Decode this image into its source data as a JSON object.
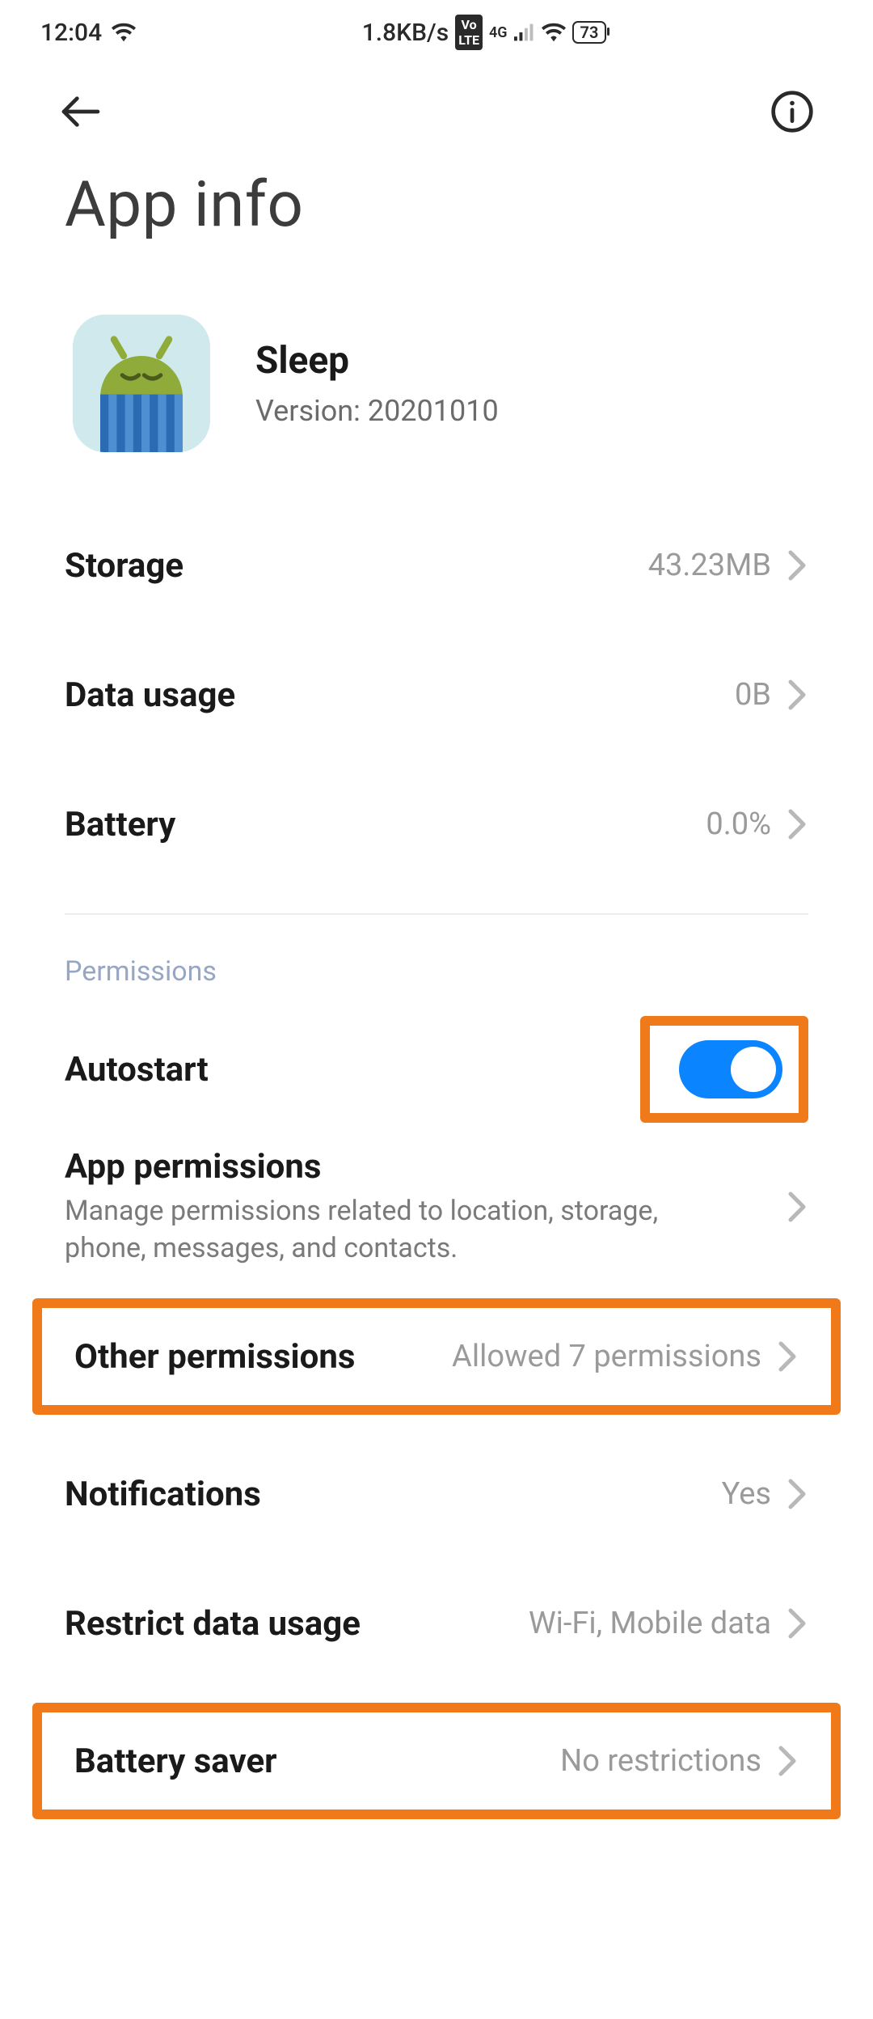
{
  "status_bar": {
    "time": "12:04",
    "speed": "1.8KB/s",
    "volte": "VoLTE",
    "network": "4G",
    "battery_pct": "73"
  },
  "page": {
    "title": "App info"
  },
  "app": {
    "name": "Sleep",
    "version_label": "Version: 20201010"
  },
  "rows": {
    "storage": {
      "label": "Storage",
      "value": "43.23MB"
    },
    "data_usage": {
      "label": "Data usage",
      "value": "0B"
    },
    "battery": {
      "label": "Battery",
      "value": "0.0%"
    }
  },
  "permissions_section": {
    "label": "Permissions",
    "autostart": {
      "label": "Autostart",
      "on": true
    },
    "app_permissions": {
      "label": "App permissions",
      "sub": "Manage permissions related to location, storage, phone, messages, and contacts."
    },
    "other_permissions": {
      "label": "Other permissions",
      "value": "Allowed 7 permissions"
    },
    "notifications": {
      "label": "Notifications",
      "value": "Yes"
    },
    "restrict_data": {
      "label": "Restrict data usage",
      "value": "Wi-Fi, Mobile data"
    },
    "battery_saver": {
      "label": "Battery saver",
      "value": "No restrictions"
    }
  },
  "highlights": {
    "autostart_toggle": true,
    "other_permissions": true,
    "battery_saver": true
  }
}
